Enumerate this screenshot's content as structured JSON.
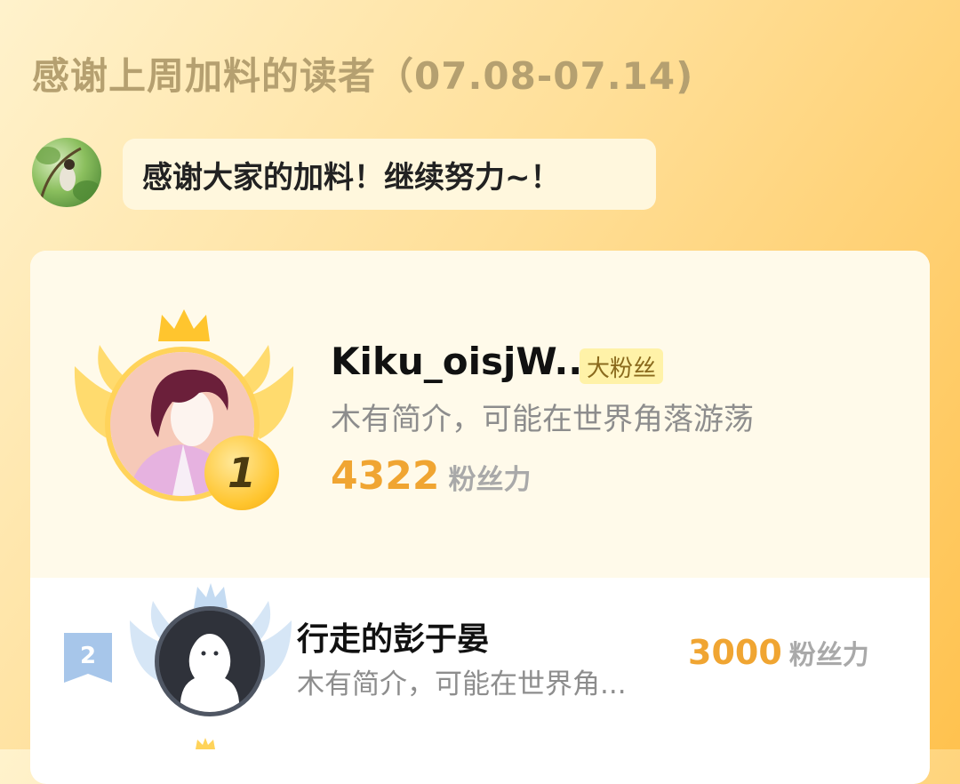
{
  "header": {
    "title": "感谢上周加料的读者（07.08-07.14)"
  },
  "author_message": {
    "text": "感谢大家的加料！继续努力~！"
  },
  "ranking": [
    {
      "rank": "1",
      "name": "Kiku_oisjW...",
      "badge": "大粉丝",
      "intro": "木有简介，可能在世界角落游荡",
      "points": "4322",
      "points_unit": "粉丝力"
    },
    {
      "rank": "2",
      "name": "行走的彭于晏",
      "intro": "木有简介，可能在世界角...",
      "points": "3000",
      "points_unit": "粉丝力"
    }
  ],
  "colors": {
    "points": "#f0a532",
    "gold": "#ffc52e",
    "badge_bg": "#fff2a8"
  }
}
